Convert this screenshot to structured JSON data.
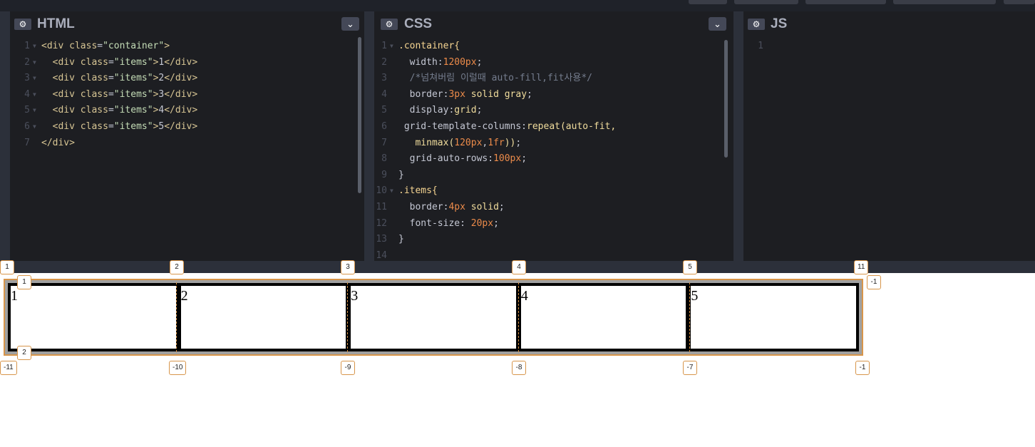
{
  "panes": {
    "html": {
      "title": "HTML",
      "gear": "gear-icon",
      "chevron": "chevron-down-icon"
    },
    "css": {
      "title": "CSS",
      "gear": "gear-icon",
      "chevron": "chevron-down-icon"
    },
    "js": {
      "title": "JS",
      "gear": "gear-icon"
    }
  },
  "html_lines": [
    {
      "n": "1",
      "fold": "▼",
      "parts": [
        [
          "tag",
          "<div "
        ],
        [
          "attr",
          "class"
        ],
        [
          "prop",
          "="
        ],
        [
          "str",
          "\"container\""
        ],
        [
          "tag",
          ">"
        ]
      ]
    },
    {
      "n": "2",
      "fold": "▼",
      "parts": [
        [
          "prop",
          "  "
        ],
        [
          "tag",
          "<div "
        ],
        [
          "attr",
          "class"
        ],
        [
          "prop",
          "="
        ],
        [
          "str",
          "\"items\""
        ],
        [
          "tag",
          ">"
        ],
        [
          "prop",
          "1"
        ],
        [
          "tag",
          "</div>"
        ]
      ]
    },
    {
      "n": "3",
      "fold": "▼",
      "parts": [
        [
          "prop",
          "  "
        ],
        [
          "tag",
          "<div "
        ],
        [
          "attr",
          "class"
        ],
        [
          "prop",
          "="
        ],
        [
          "str",
          "\"items\""
        ],
        [
          "tag",
          ">"
        ],
        [
          "prop",
          "2"
        ],
        [
          "tag",
          "</div>"
        ]
      ]
    },
    {
      "n": "4",
      "fold": "▼",
      "parts": [
        [
          "prop",
          "  "
        ],
        [
          "tag",
          "<div "
        ],
        [
          "attr",
          "class"
        ],
        [
          "prop",
          "="
        ],
        [
          "str",
          "\"items\""
        ],
        [
          "tag",
          ">"
        ],
        [
          "prop",
          "3"
        ],
        [
          "tag",
          "</div>"
        ]
      ]
    },
    {
      "n": "5",
      "fold": "▼",
      "parts": [
        [
          "prop",
          "  "
        ],
        [
          "tag",
          "<div "
        ],
        [
          "attr",
          "class"
        ],
        [
          "prop",
          "="
        ],
        [
          "str",
          "\"items\""
        ],
        [
          "tag",
          ">"
        ],
        [
          "prop",
          "4"
        ],
        [
          "tag",
          "</div>"
        ]
      ]
    },
    {
      "n": "6",
      "fold": "▼",
      "parts": [
        [
          "prop",
          "  "
        ],
        [
          "tag",
          "<div "
        ],
        [
          "attr",
          "class"
        ],
        [
          "prop",
          "="
        ],
        [
          "str",
          "\"items\""
        ],
        [
          "tag",
          ">"
        ],
        [
          "prop",
          "5"
        ],
        [
          "tag",
          "</div>"
        ]
      ]
    },
    {
      "n": "7",
      "fold": "",
      "parts": [
        [
          "tag",
          "</div>"
        ]
      ]
    }
  ],
  "css_lines": [
    {
      "n": "1",
      "fold": "▼",
      "parts": [
        [
          "sel",
          ".container{"
        ]
      ]
    },
    {
      "n": "2",
      "fold": "",
      "parts": [
        [
          "prop",
          "  width:"
        ],
        [
          "num",
          "1200px"
        ],
        [
          "prop",
          ";"
        ]
      ]
    },
    {
      "n": "3",
      "fold": "",
      "parts": [
        [
          "cmt",
          "  /*넘쳐버림 이럴때 auto-fill,fit사용*/"
        ]
      ]
    },
    {
      "n": "4",
      "fold": "",
      "parts": [
        [
          "prop",
          "  border:"
        ],
        [
          "num",
          "3px"
        ],
        [
          "fn",
          " solid gray"
        ],
        [
          "prop",
          ";"
        ]
      ]
    },
    {
      "n": "5",
      "fold": "",
      "parts": [
        [
          "prop",
          "  display:"
        ],
        [
          "fn",
          "grid"
        ],
        [
          "prop",
          ";"
        ]
      ]
    },
    {
      "n": "6",
      "fold": "",
      "parts": [
        [
          "prop",
          " grid-template-columns:"
        ],
        [
          "fn",
          "repeat(auto-fit,"
        ]
      ]
    },
    {
      "n": "7",
      "fold": "",
      "parts": [
        [
          "fn",
          "   minmax("
        ],
        [
          "num",
          "120px"
        ],
        [
          "prop",
          ","
        ],
        [
          "num",
          "1fr"
        ],
        [
          "fn",
          "))"
        ],
        [
          "prop",
          ";"
        ]
      ]
    },
    {
      "n": "8",
      "fold": "",
      "parts": [
        [
          "prop",
          "  grid-auto-rows:"
        ],
        [
          "num",
          "100px"
        ],
        [
          "prop",
          ";"
        ]
      ]
    },
    {
      "n": "9",
      "fold": "",
      "parts": [
        [
          "prop",
          "}"
        ]
      ]
    },
    {
      "n": "10",
      "fold": "▼",
      "parts": [
        [
          "sel",
          ".items{"
        ]
      ]
    },
    {
      "n": "11",
      "fold": "",
      "parts": [
        [
          "prop",
          "  border:"
        ],
        [
          "num",
          "4px"
        ],
        [
          "fn",
          " solid"
        ],
        [
          "prop",
          ";"
        ]
      ]
    },
    {
      "n": "12",
      "fold": "",
      "parts": [
        [
          "prop",
          "  font-size: "
        ],
        [
          "num",
          "20px"
        ],
        [
          "prop",
          ";"
        ]
      ]
    },
    {
      "n": "13",
      "fold": "",
      "parts": [
        [
          "prop",
          "}"
        ]
      ]
    },
    {
      "n": "14",
      "fold": "",
      "parts": [
        [
          "prop",
          ""
        ]
      ]
    }
  ],
  "js_lines": [
    {
      "n": "1",
      "fold": "",
      "parts": [
        [
          "prop",
          ""
        ]
      ]
    }
  ],
  "preview": {
    "items": [
      "1",
      "2",
      "3",
      "4",
      "5"
    ],
    "col_badges_top": [
      "1",
      "2",
      "3",
      "4",
      "5",
      "11"
    ],
    "col_badges_bottom": [
      "-11",
      "-10",
      "-9",
      "-8",
      "-7",
      "-1"
    ],
    "row_badges_left": [
      "1",
      "2"
    ],
    "row_badge_right": "-1"
  }
}
